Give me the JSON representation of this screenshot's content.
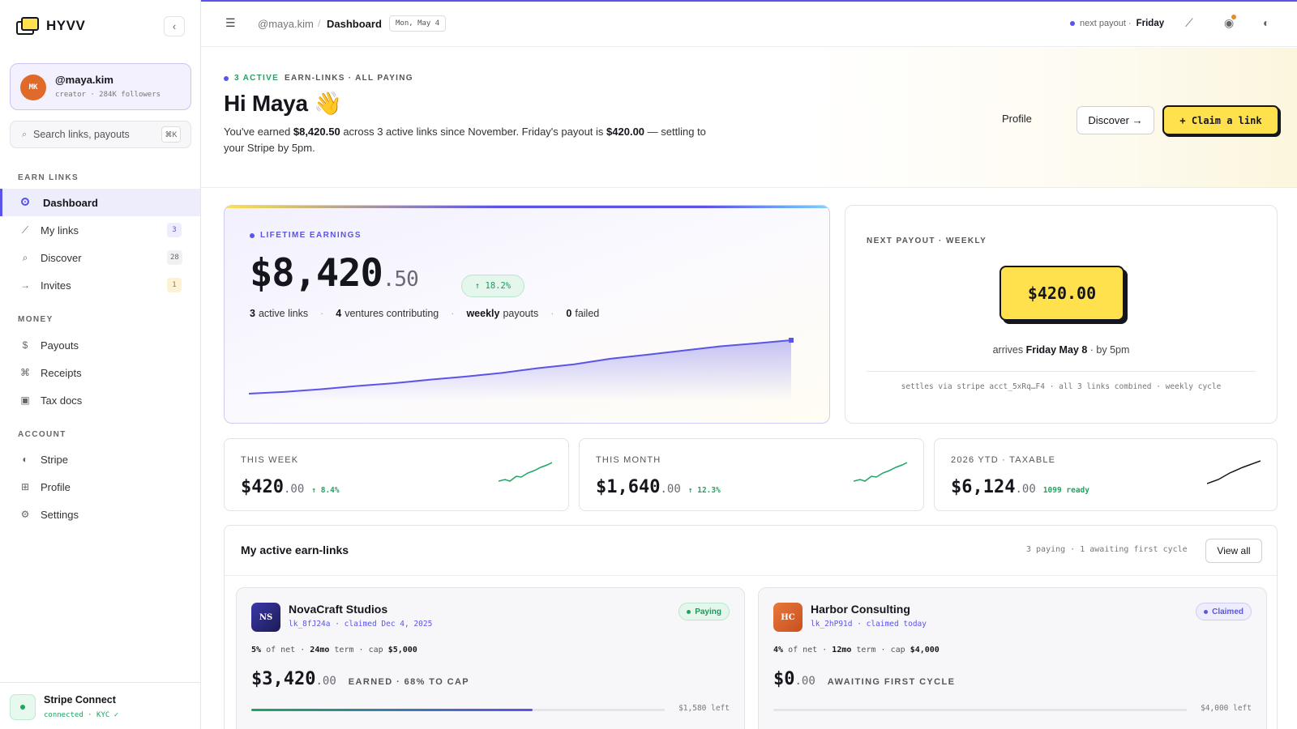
{
  "brand": {
    "name": "HYVV"
  },
  "user": {
    "initials": "MK",
    "handle": "@maya.kim",
    "sub": "creator · 284K followers"
  },
  "search": {
    "placeholder": "Search links, payouts",
    "shortcut": "⌘K"
  },
  "sidebar": {
    "sections": [
      {
        "title": "EARN LINKS"
      },
      {
        "title": "MONEY"
      },
      {
        "title": "ACCOUNT"
      }
    ],
    "items": [
      {
        "label": "Dashboard",
        "icon": "target-icon"
      },
      {
        "label": "My links",
        "icon": "link-icon",
        "badge": "3"
      },
      {
        "label": "Discover",
        "icon": "search-icon",
        "badge": "28"
      },
      {
        "label": "Invites",
        "icon": "arrow-right-icon",
        "badge": "1"
      },
      {
        "label": "Payouts",
        "icon": "dollar-icon"
      },
      {
        "label": "Receipts",
        "icon": "command-icon"
      },
      {
        "label": "Tax docs",
        "icon": "document-icon"
      },
      {
        "label": "Stripe",
        "icon": "half-circle-icon"
      },
      {
        "label": "Profile",
        "icon": "grid-icon"
      },
      {
        "label": "Settings",
        "icon": "gear-icon"
      }
    ],
    "stripe": {
      "title": "Stripe Connect",
      "sub": "connected · KYC ✓"
    }
  },
  "topbar": {
    "breadcrumb_user": "@maya.kim",
    "breadcrumb_sep": "/",
    "breadcrumb_page": "Dashboard",
    "date": "Mon, May 4",
    "payout_label": "next payout ·",
    "payout_day": "Friday"
  },
  "hero": {
    "kicker_active": "3 ACTIVE",
    "kicker_rest": "EARN-LINKS · ALL PAYING",
    "title": "Hi Maya 👋",
    "desc_1": "You've earned ",
    "desc_amt": "$8,420.50",
    "desc_2": " across 3 active links since November. Friday's payout is ",
    "desc_payout": "$420.00",
    "desc_3": " — settling to your Stripe by 5pm.",
    "btn_profile": "Profile",
    "btn_discover": "Discover →",
    "btn_claim": "+ Claim a link"
  },
  "lifetime": {
    "label": "LIFETIME EARNINGS",
    "amount_main": "$8,420",
    "amount_cents": ".50",
    "change": "↑ 18.2%",
    "stats": [
      {
        "value": "3",
        "label": "active links"
      },
      {
        "value": "4",
        "label": "ventures contributing"
      },
      {
        "value": "weekly",
        "label": "payouts"
      },
      {
        "value": "0",
        "label": "failed"
      }
    ],
    "sep": "·",
    "line_color": "#5b54e8"
  },
  "chart_data": {
    "type": "area",
    "title": "",
    "series": [
      {
        "values": [
          0,
          120,
          300,
          520,
          700,
          940,
          1150,
          1400,
          1720,
          1980,
          2350,
          2620,
          2900,
          3180,
          3380,
          3600
        ]
      }
    ]
  },
  "next_payout": {
    "label": "NEXT PAYOUT · WEEKLY",
    "amount": "$420.00",
    "arrives_pre": "arrives ",
    "arrives_day": "Friday May 8",
    "arrives_post": " · by 5pm",
    "footnote": "settles via stripe acct_5xRq…F4 · all 3 links combined · weekly cycle"
  },
  "stats": [
    {
      "label": "THIS WEEK",
      "main": "$420",
      "cents": ".00",
      "delta": "↑ 8.4%",
      "spark_color": "#1fa463"
    },
    {
      "label": "THIS MONTH",
      "main": "$1,640",
      "cents": ".00",
      "delta": "↑ 12.3%",
      "spark_color": "#1fa463"
    },
    {
      "label": "2026 YTD · TAXABLE",
      "main": "$6,124",
      "cents": ".00",
      "delta": "1099 ready",
      "spark_color": "#15151c"
    }
  ],
  "earn_links": {
    "title": "My active earn-links",
    "meta": "3 paying · 1 awaiting first cycle",
    "view_all": "View all",
    "cards": [
      {
        "initials": "NS",
        "logo_color": "#2c2a7a",
        "name": "NovaCraft Studios",
        "id": "lk_8fJ24a · claimed Dec 4, 2025",
        "status": "Paying",
        "terms_pct": "5%",
        "terms_pct_label": " of net",
        "terms_dot": "·",
        "term": "24mo",
        "term_label": " term",
        "cap_label": "cap ",
        "cap": "$5,000",
        "earned_main": "$3,420",
        "earned_cents": ".00",
        "tag": "EARNED · 68% TO CAP",
        "progress": 0.68,
        "left": "$1,580 left"
      },
      {
        "initials": "HC",
        "logo_color": "#d9612a",
        "name": "Harbor Consulting",
        "id": "lk_2hP91d · claimed today",
        "status": "Claimed",
        "terms_pct": "4%",
        "terms_pct_label": " of net",
        "terms_dot": "·",
        "term": "12mo",
        "term_label": " term",
        "cap_label": "cap ",
        "cap": "$4,000",
        "earned_main": "$0",
        "earned_cents": ".00",
        "tag": "AWAITING FIRST CYCLE",
        "progress": 0,
        "left": "$4,000 left"
      }
    ]
  },
  "colors": {
    "accent": "#5b54e8",
    "yellow": "#ffe14d",
    "green": "#1fa463",
    "paying_bg": "#e5f7ed",
    "claimed_bg": "#eeedfc"
  }
}
